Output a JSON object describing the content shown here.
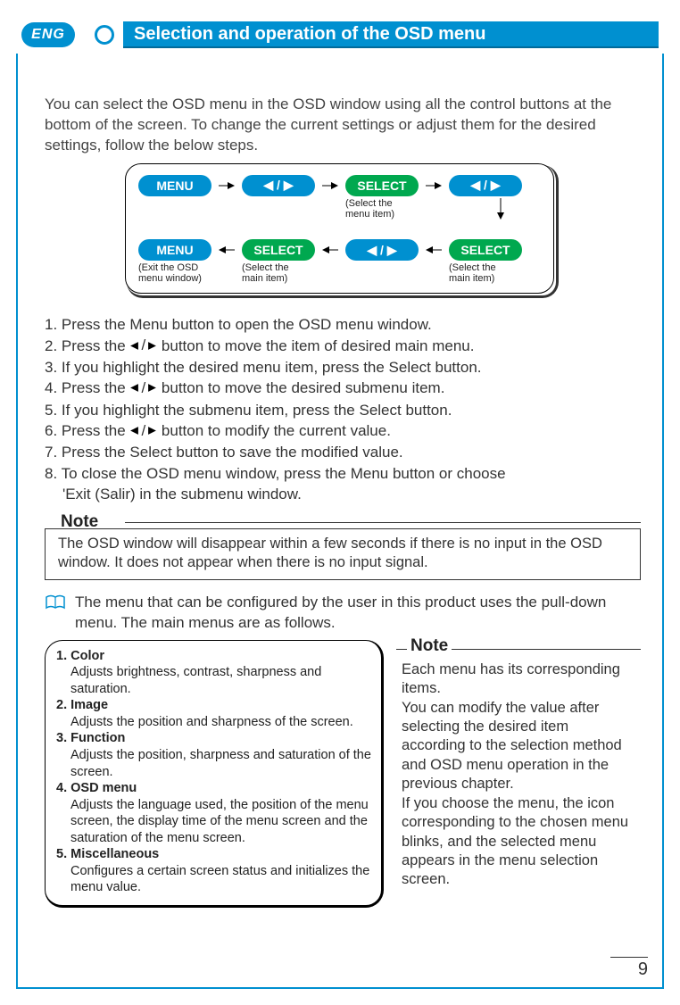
{
  "header": {
    "lang": "ENG",
    "title": "Selection and operation of the OSD menu"
  },
  "intro": "You can select the OSD menu in the OSD window using all the control buttons at the bottom of the screen. To change the current settings or adjust them for the desired settings, follow the below steps.",
  "flow": {
    "row1": {
      "menu_label": "MENU",
      "arrows_label": "◀ / ▶",
      "select_label": "SELECT",
      "select_caption": "(Select the\nmenu item)"
    },
    "row2": {
      "menu_label": "MENU",
      "menu_caption": "(Exit the OSD\nmenu window)",
      "select1_label": "SELECT",
      "select1_caption": "(Select the\nmain item)",
      "arrows_label": "◀ / ▶",
      "select2_label": "SELECT",
      "select2_caption": "(Select the\nmain item)"
    }
  },
  "steps": {
    "s1": "1. Press the Menu button to open the OSD menu window.",
    "s2a": "2. Press the ",
    "s2b": " button to move the item of desired main menu.",
    "s3": "3. If you highlight the desired menu item, press the Select button.",
    "s4a": "4. Press the ",
    "s4b": " button to move the desired submenu item.",
    "s5": "5. If you highlight the submenu item, press the Select button.",
    "s6a": "6. Press the ",
    "s6b": " button to modify the current value.",
    "s7": "7. Press the Select button to save the modified value.",
    "s8a": "8. To close the OSD menu window, press the Menu button or choose",
    "s8b": "'Exit (Salir) in the submenu window."
  },
  "note1": {
    "label": "Note",
    "text": "The OSD window will disappear within a few seconds if there is no input in the OSD window. It does not appear when there is no input signal."
  },
  "pulldown_text": "The menu that can be configured by the user in this product uses the pull-down menu. The main menus are as follows.",
  "menus": {
    "m1": {
      "title": "1. Color",
      "desc": "Adjusts brightness, contrast, sharpness and saturation."
    },
    "m2": {
      "title": "2.  Image",
      "desc": "Adjusts the position and sharpness of the screen."
    },
    "m3": {
      "title": "3. Function",
      "desc": "Adjusts the position, sharpness and saturation of the screen."
    },
    "m4": {
      "title": "4. OSD menu",
      "desc": "Adjusts the language used, the position of the menu screen, the display time of the menu screen and the saturation of the menu screen."
    },
    "m5": {
      "title": "5. Miscellaneous",
      "desc": "Configures a certain screen status and initializes the menu value."
    }
  },
  "note2": {
    "label": "Note",
    "text": "Each menu has its corresponding items.\nYou can modify the value after selecting the desired item according to the selection method and OSD menu operation in the previous chapter.\nIf you choose the menu, the icon corresponding to the chosen menu blinks, and the selected menu appears in the menu selection screen."
  },
  "page_number": "9"
}
